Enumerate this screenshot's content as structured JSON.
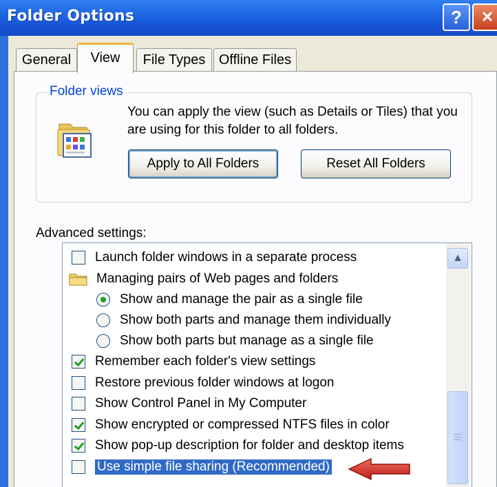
{
  "window": {
    "title": "Folder Options",
    "help_glyph": "?",
    "close_glyph": "✕"
  },
  "tabs": [
    {
      "label": "General",
      "active": false
    },
    {
      "label": "View",
      "active": true
    },
    {
      "label": "File Types",
      "active": false
    },
    {
      "label": "Offline Files",
      "active": false
    }
  ],
  "folder_views": {
    "legend": "Folder views",
    "description": "You can apply the view (such as Details or Tiles) that you are using for this folder to all folders.",
    "apply_button": "Apply to All Folders",
    "reset_button": "Reset All Folders",
    "icon": "folder-view-icon"
  },
  "advanced": {
    "label": "Advanced settings:",
    "items": [
      {
        "type": "checkbox",
        "label": "Launch folder windows in a separate process",
        "checked": false
      },
      {
        "type": "folder",
        "label": "Managing pairs of Web pages and folders"
      },
      {
        "type": "radio",
        "label": "Show and manage the pair as a single file",
        "checked": true
      },
      {
        "type": "radio",
        "label": "Show both parts and manage them individually",
        "checked": false
      },
      {
        "type": "radio",
        "label": "Show both parts but manage as a single file",
        "checked": false
      },
      {
        "type": "checkbox",
        "label": "Remember each folder's view settings",
        "checked": true
      },
      {
        "type": "checkbox",
        "label": "Restore previous folder windows at logon",
        "checked": false
      },
      {
        "type": "checkbox",
        "label": "Show Control Panel in My Computer",
        "checked": false
      },
      {
        "type": "checkbox",
        "label": "Show encrypted or compressed NTFS files in color",
        "checked": true
      },
      {
        "type": "checkbox",
        "label": "Show pop-up description for folder and desktop items",
        "checked": true
      },
      {
        "type": "checkbox",
        "label": "Use simple file sharing (Recommended)",
        "checked": false,
        "selected": true
      }
    ]
  },
  "colors": {
    "title_bar": "#1a5ddf",
    "dialog_bg": "#ece9d8",
    "selection": "#316ac5",
    "check": "#21a121",
    "arrow": "#d8322a"
  }
}
